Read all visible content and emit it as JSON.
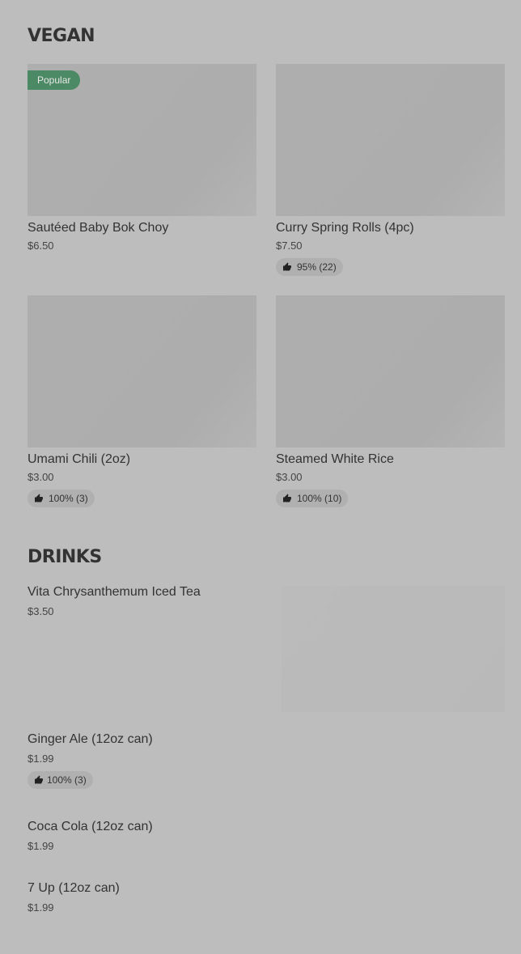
{
  "vegan": {
    "title": "VEGAN",
    "items": [
      {
        "name": "Sautéed Baby Bok Choy",
        "price": "$6.50",
        "badge": "Popular"
      },
      {
        "name": "Curry Spring Rolls (4pc)",
        "price": "$7.50",
        "rating": "95% (22)"
      },
      {
        "name": "Umami Chili (2oz)",
        "price": "$3.00",
        "rating": "100% (3)"
      },
      {
        "name": "Steamed White Rice",
        "price": "$3.00",
        "rating": "100% (10)"
      }
    ]
  },
  "drinks": {
    "title": "DRINKS",
    "items": [
      {
        "name": "Vita Chrysanthemum Iced Tea",
        "price": "$3.50"
      },
      {
        "name": "Ginger Ale (12oz can)",
        "price": "$1.99",
        "rating": "100% (3)"
      },
      {
        "name": "Coca Cola (12oz can)",
        "price": "$1.99"
      },
      {
        "name": "7 Up (12oz can)",
        "price": "$1.99"
      }
    ]
  },
  "icons": {
    "rating": "thumbs-up-icon"
  },
  "colors": {
    "background": "#bdbdbd",
    "badge": "#4b8a64",
    "image_placeholder": "#afafaf"
  }
}
